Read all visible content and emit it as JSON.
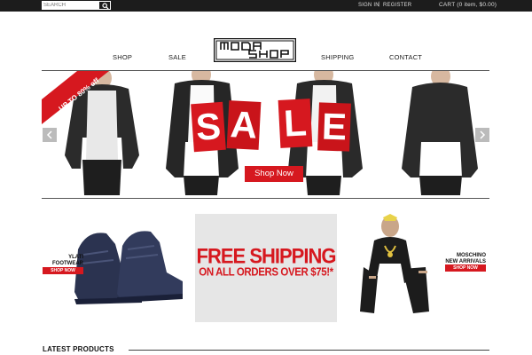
{
  "topbar": {
    "search_placeholder": "SEARCH",
    "sign_in": "SIGN IN",
    "separator": "|",
    "register": "REGISTER",
    "cart": "CART (0 item, $0.00)"
  },
  "nav": {
    "shop": "SHOP",
    "sale": "SALE",
    "shipping": "SHIPPING",
    "contact": "CONTACT"
  },
  "logo": {
    "text": "MODA SHOP"
  },
  "banner": {
    "ribbon": "UP TO 80% off",
    "sale_letters": [
      "S",
      "A",
      "L",
      "E"
    ],
    "shop_now": "Shop Now"
  },
  "promos": {
    "left": {
      "title_line1": "YLATI",
      "title_line2": "FOOTWEAR",
      "button": "SHOP NOW"
    },
    "center": {
      "line1": "FREE SHIPPING",
      "line2": "ON ALL ORDERS OVER $75!*"
    },
    "right": {
      "title_line1": "MOSCHINO",
      "title_line2": "NEW ARRIVALS",
      "button": "SHOP NOW"
    }
  },
  "latest": {
    "heading": "LATEST PRODUCTS"
  },
  "colors": {
    "accent": "#d6181f",
    "topbar": "#1c1c1c"
  }
}
